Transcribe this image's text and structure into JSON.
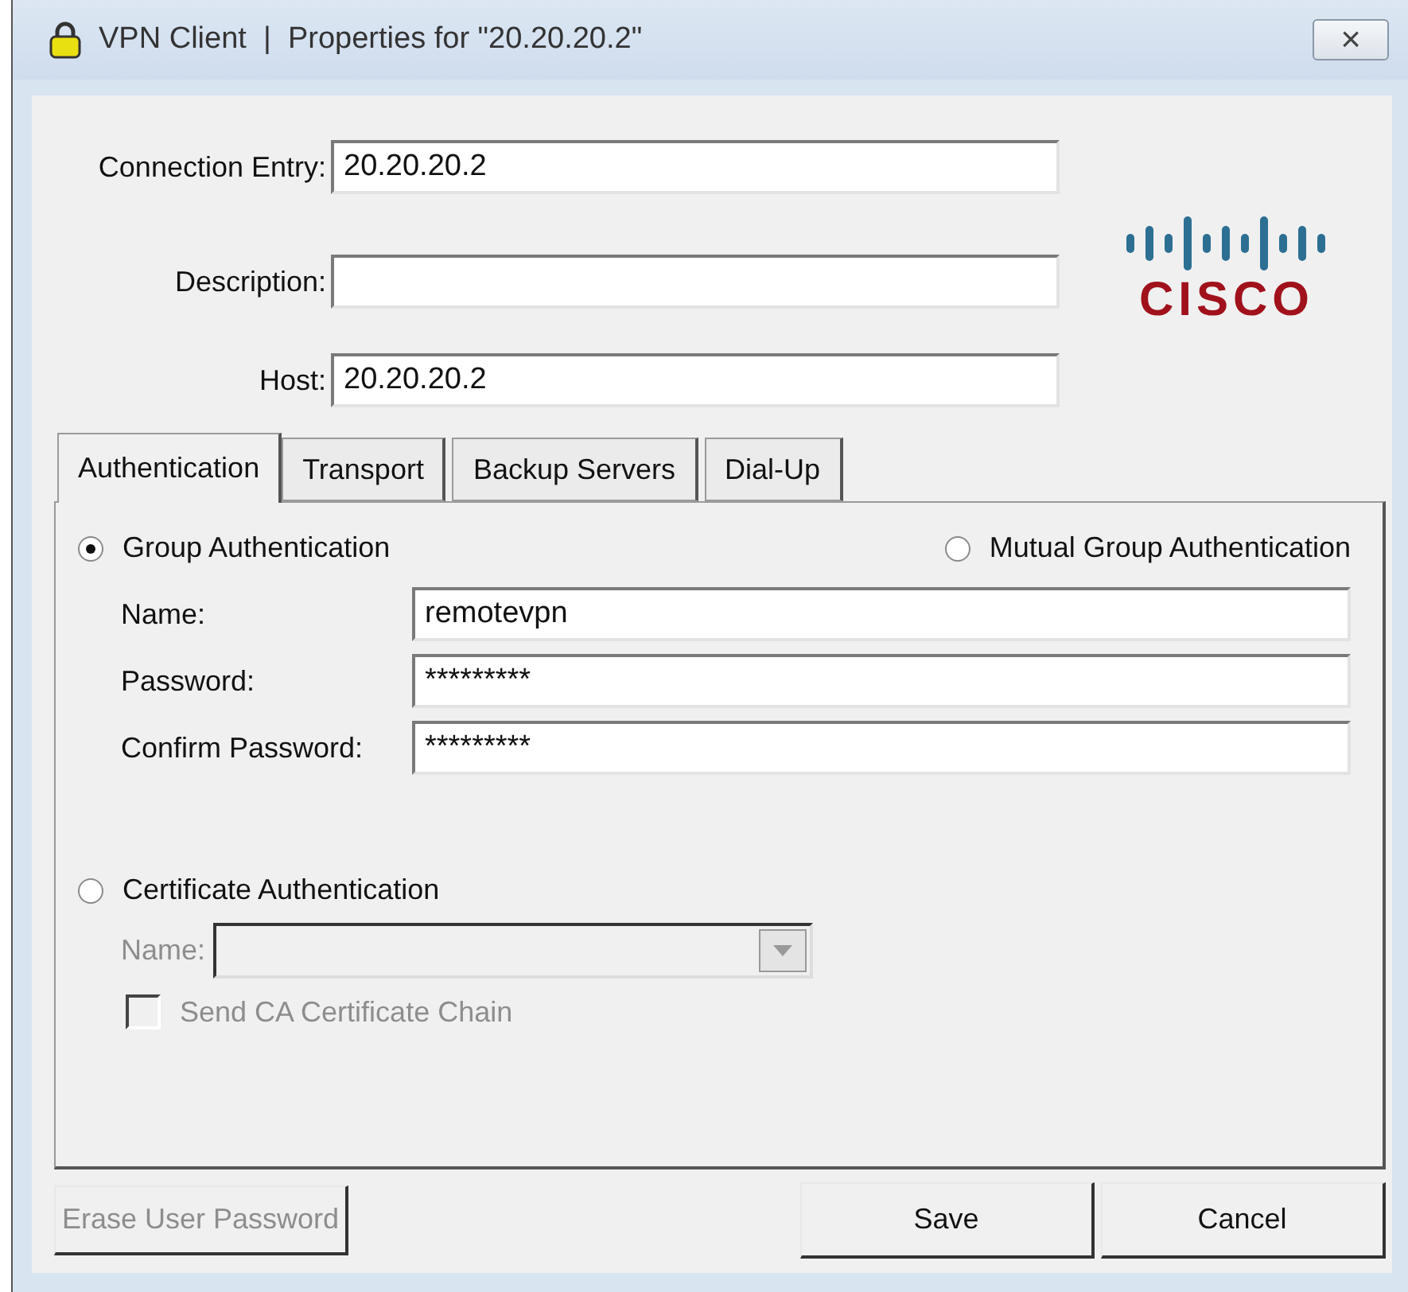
{
  "window": {
    "title": "VPN Client  |  Properties for \"20.20.20.2\"",
    "close": "×"
  },
  "fields": [
    {
      "label": "Connection Entry:",
      "value": "20.20.20.2"
    },
    {
      "label": "Description:"
    },
    {
      "label": "Host:",
      "value": "20.20.20.2"
    }
  ],
  "logo": {
    "text": "CISCO"
  },
  "tabs": [
    {
      "label": "Authentication",
      "selected": true
    },
    {
      "label": "Transport",
      "selected": false
    },
    {
      "label": "Backup Servers",
      "selected": false
    },
    {
      "label": "Dial-Up",
      "selected": false
    }
  ],
  "group_authentication": {
    "label": "Group Authentication",
    "selected": true,
    "fields": [
      {
        "label": "Name:",
        "value": "remotevpn"
      },
      {
        "label": "Password:",
        "value": "*********"
      },
      {
        "label": "Confirm Password:",
        "value": "*********"
      }
    ]
  },
  "mutual_group_authentication": {
    "label": "Mutual Group Authentication",
    "selected": false
  },
  "certificate_authentication": {
    "label": "Certificate Authentication",
    "selected": false,
    "name_label": "Name:",
    "disabled": true,
    "send_chain": {
      "label": "Send CA Certificate Chain",
      "checked": false
    }
  },
  "buttons": [
    {
      "label": "Erase User Password",
      "disabled": true
    },
    {
      "label": "Save",
      "disabled": false
    },
    {
      "label": "Cancel",
      "disabled": false
    }
  ]
}
